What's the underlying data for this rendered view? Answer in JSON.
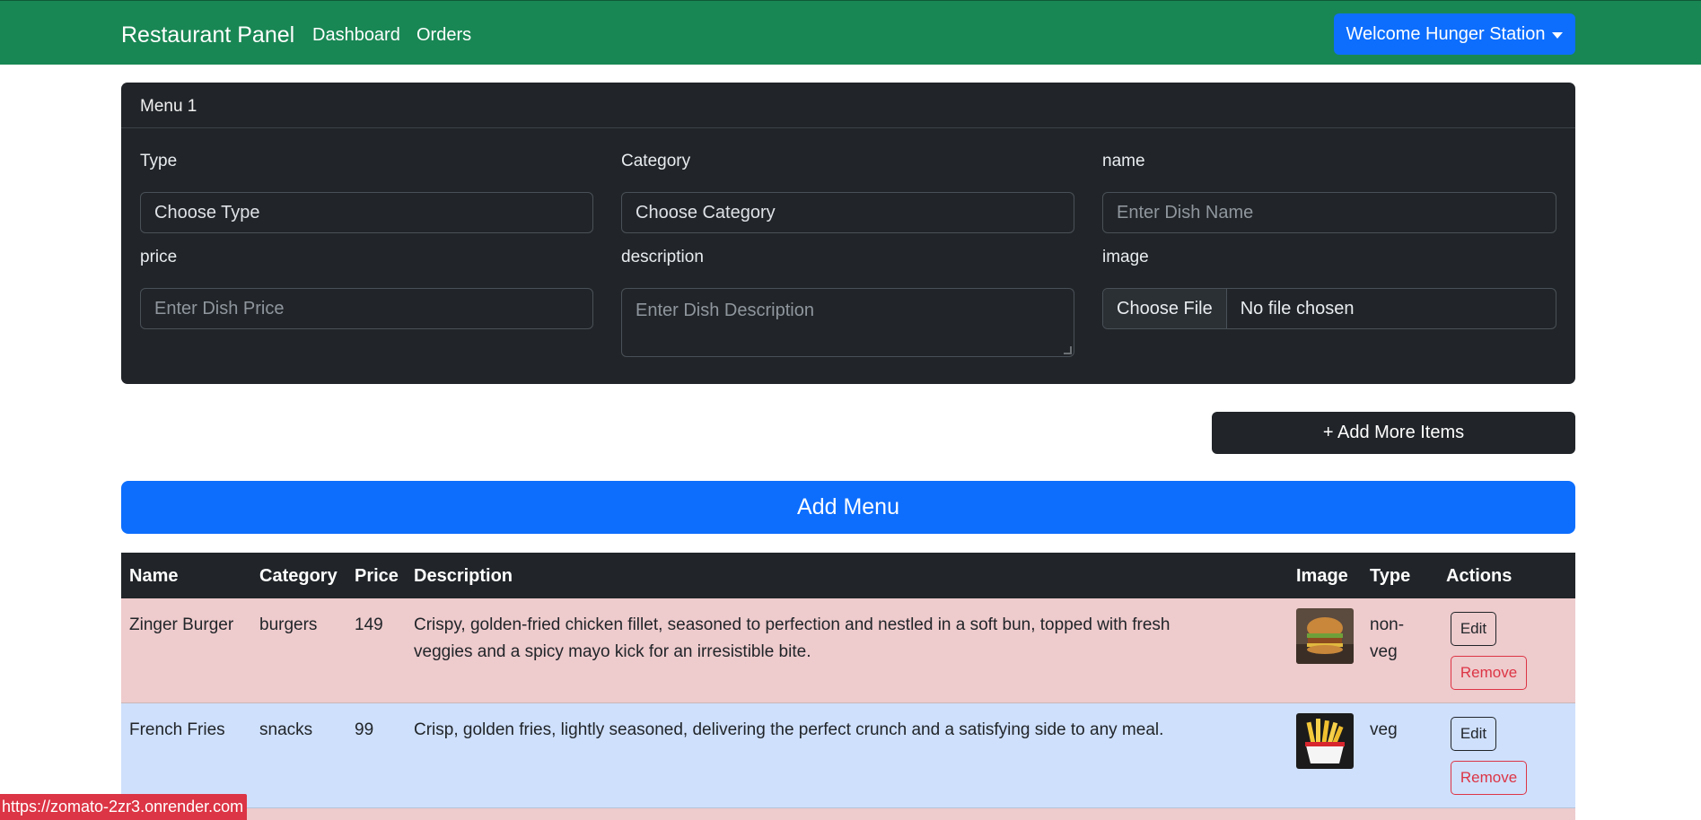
{
  "navbar": {
    "brand": "Restaurant Panel",
    "links": [
      "Dashboard",
      "Orders"
    ],
    "welcome_label": "Welcome Hunger Station"
  },
  "form": {
    "card_title": "Menu 1",
    "type_label": "Type",
    "type_value": "Choose Type",
    "category_label": "Category",
    "category_value": "Choose Category",
    "name_label": "name",
    "name_placeholder": "Enter Dish Name",
    "price_label": "price",
    "price_placeholder": "Enter Dish Price",
    "description_label": "description",
    "description_placeholder": "Enter Dish Description",
    "image_label": "image",
    "file_button": "Choose File",
    "file_status": "No file chosen"
  },
  "buttons": {
    "add_more": "+ Add More Items",
    "add_menu": "Add Menu"
  },
  "table": {
    "headers": [
      "Name",
      "Category",
      "Price",
      "Description",
      "Image",
      "Type",
      "Actions"
    ],
    "rows": [
      {
        "name": "Zinger Burger",
        "category": "burgers",
        "price": "149",
        "description_line1": "Crispy, golden-fried chicken fillet, seasoned to perfection and nestled in a soft bun, topped with fresh",
        "description_line2": "veggies and a spicy mayo kick for an irresistible bite.",
        "type_line1": "non-",
        "type_line2": "veg",
        "edit": "Edit",
        "remove": "Remove"
      },
      {
        "name": "French Fries",
        "category": "snacks",
        "price": "99",
        "description_line1": "Crisp, golden fries, lightly seasoned, delivering the perfect crunch and a satisfying side to any meal.",
        "type_line1": "veg",
        "edit": "Edit",
        "remove": "Remove"
      }
    ]
  },
  "status_bar": {
    "url": "https://zomato-2zr3.onrender.com"
  },
  "colors": {
    "navbar": "#198754",
    "primary": "#0d6efd",
    "dark": "#212529",
    "row_danger": "#eecbcd",
    "row_primary": "#cfe0fc",
    "remove": "#dc3545"
  }
}
